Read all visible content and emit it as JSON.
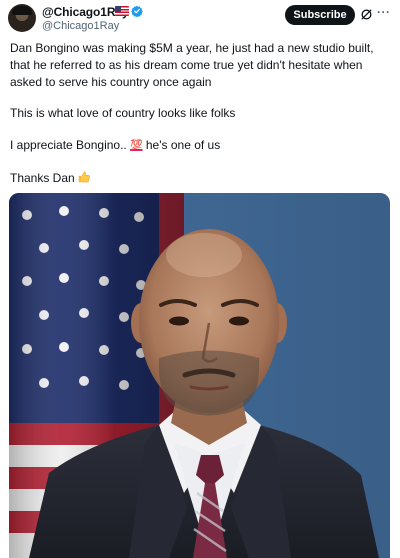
{
  "author": {
    "display_name": "@Chicago1Ray",
    "handle": "@Chicago1Ray",
    "flag_icon": "us-flag-icon",
    "verified_icon": "verified-badge-icon",
    "verified_color": "#1d9bf0"
  },
  "actions": {
    "subscribe_label": "Subscribe",
    "grok_icon": "grok-icon",
    "more_label": "···"
  },
  "tweet": {
    "para1": "Dan Bongino was making $5M a year, he just had a new studio built, that he referred to as his dream come true yet didn't hesitate when asked to serve his country once again",
    "para2": "This is what love of country looks like folks",
    "para3_before": "I appreciate Bongino.. ",
    "para3_emoji": "💯",
    "para3_after": " he's one of us",
    "para4": "Thanks Dan",
    "para4_emoji": "👍"
  },
  "colors": {
    "text": "#0f1419",
    "secondary": "#536471",
    "button_bg": "#0f1419",
    "hundred_red": "#e0245e"
  }
}
